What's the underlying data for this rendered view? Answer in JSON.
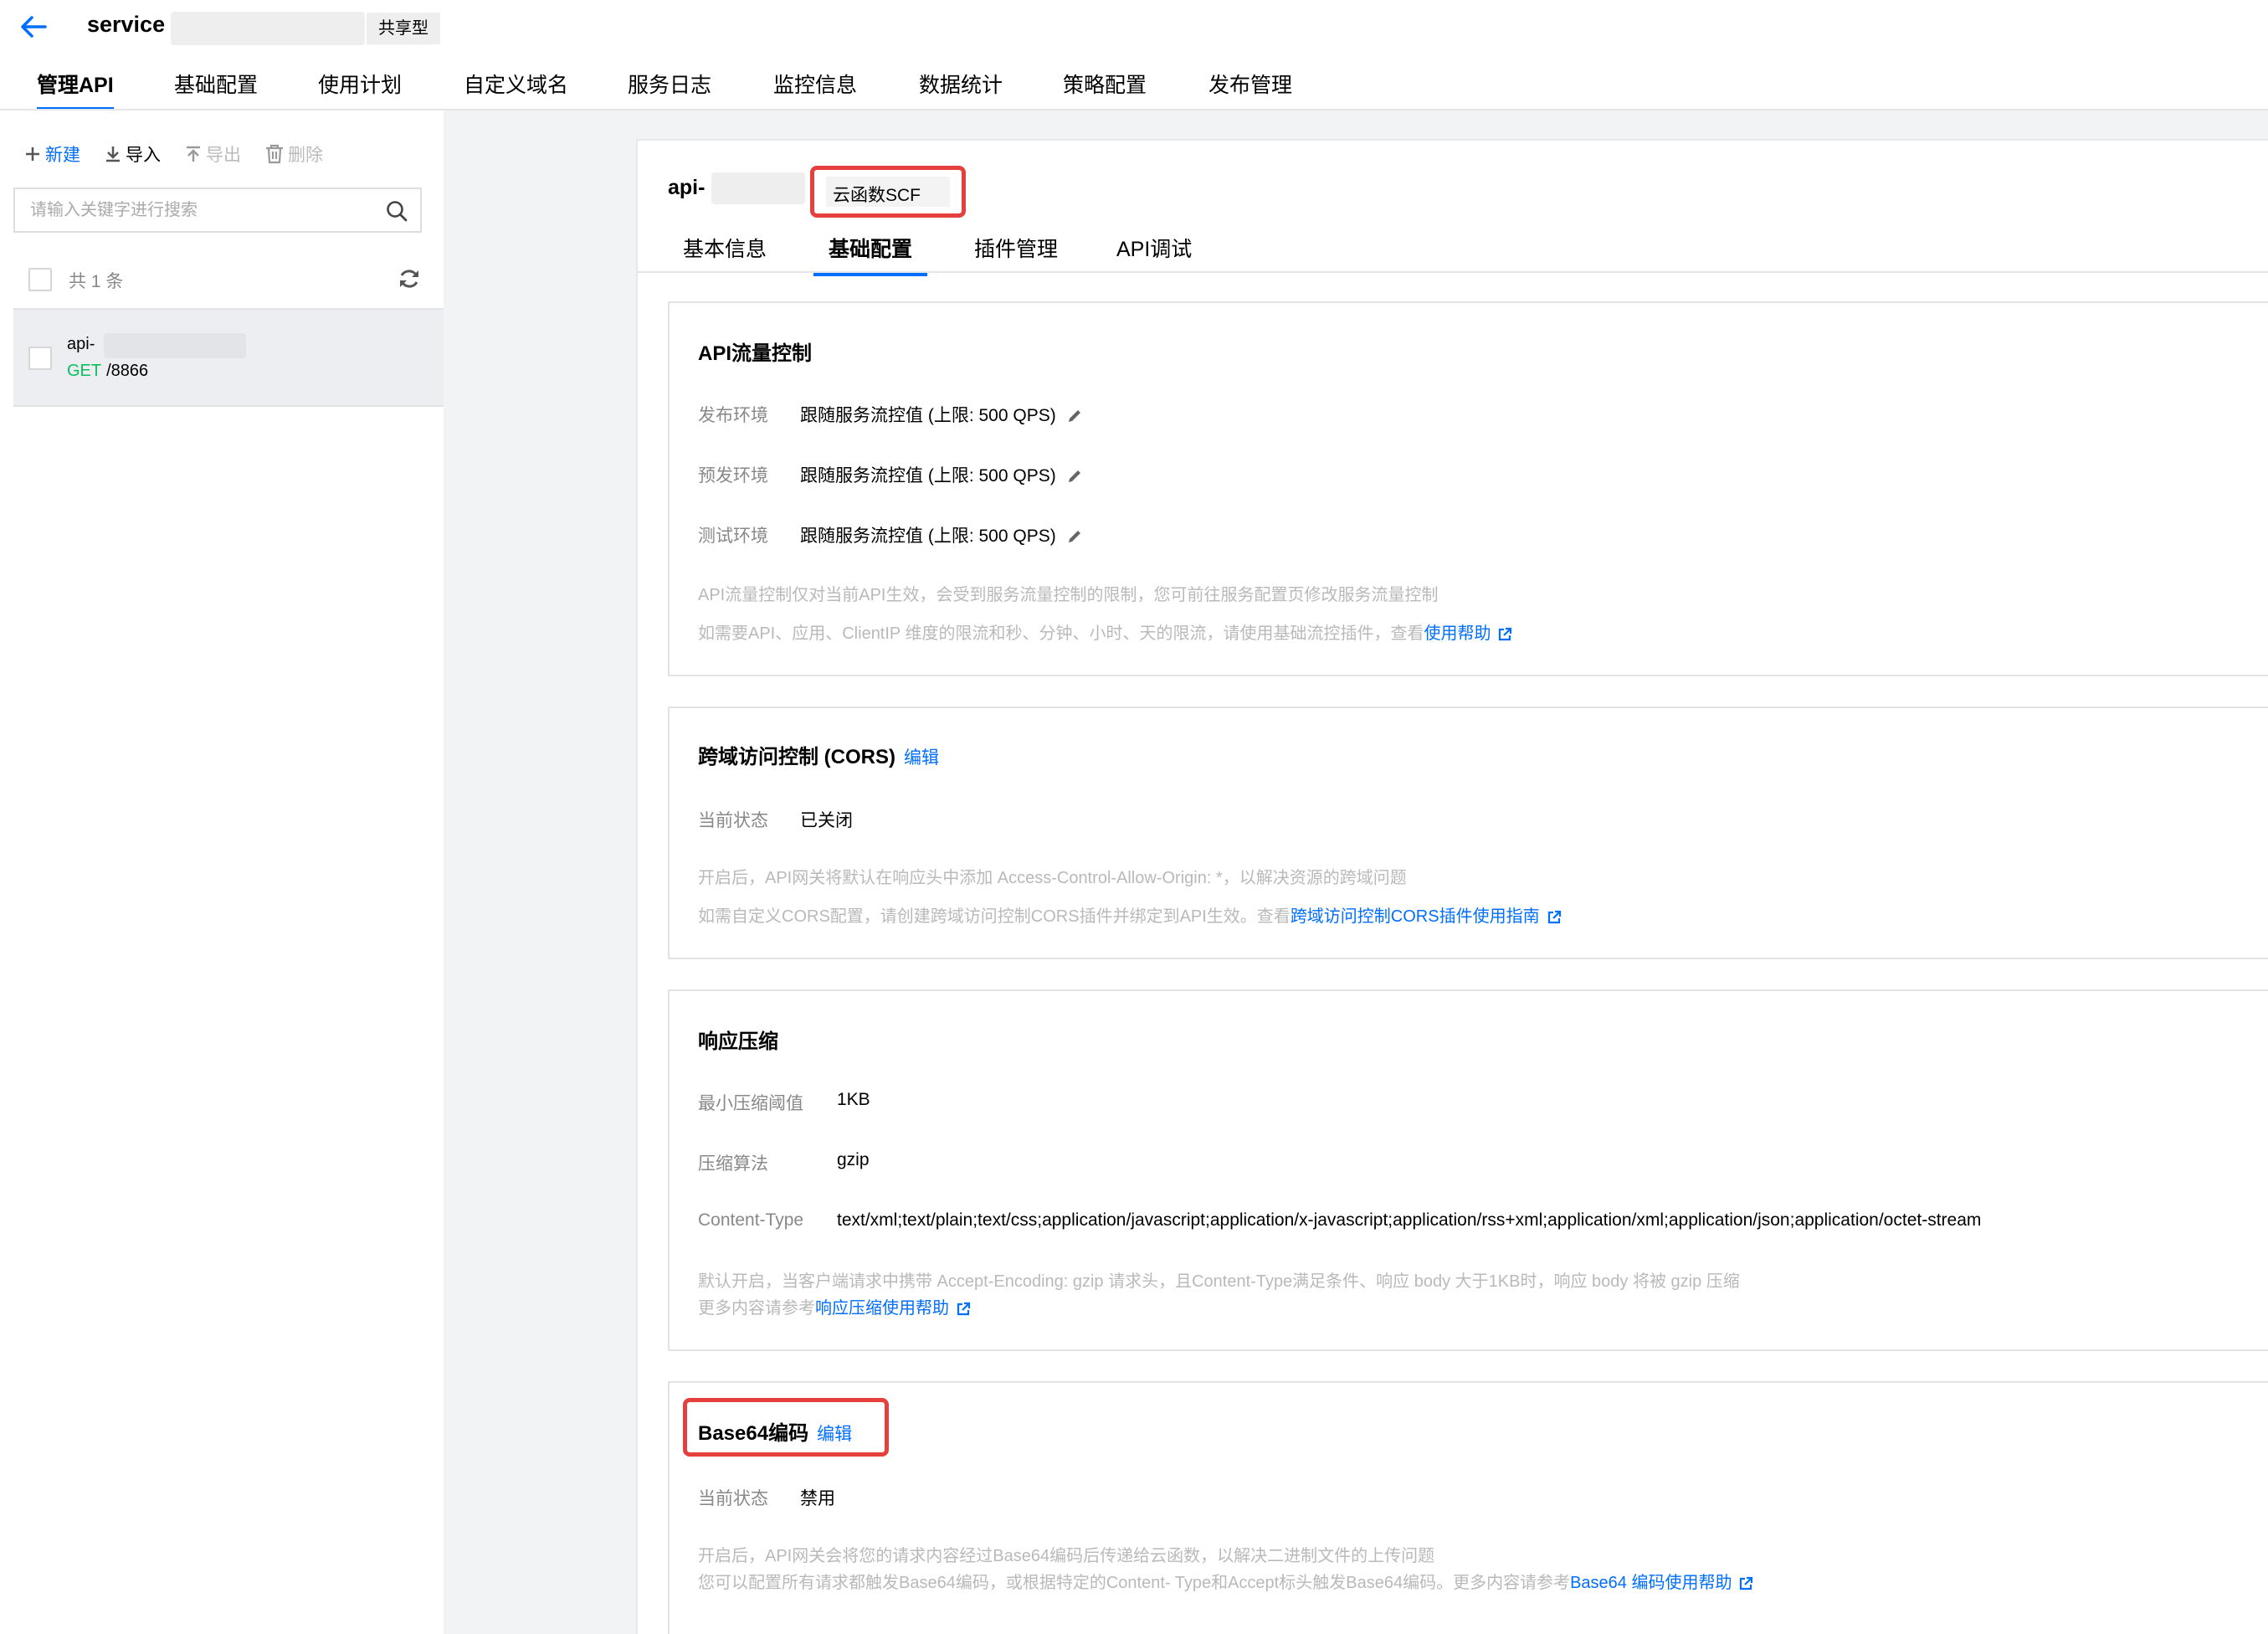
{
  "header": {
    "service_name": "service",
    "service_type": "共享型"
  },
  "main_tabs": [
    {
      "label": "管理API",
      "active": true
    },
    {
      "label": "基础配置"
    },
    {
      "label": "使用计划"
    },
    {
      "label": "自定义域名"
    },
    {
      "label": "服务日志"
    },
    {
      "label": "监控信息"
    },
    {
      "label": "数据统计"
    },
    {
      "label": "策略配置"
    },
    {
      "label": "发布管理"
    }
  ],
  "left_panel": {
    "toolbar": {
      "new": "新建",
      "import": "导入",
      "export": "导出",
      "delete": "删除"
    },
    "search_placeholder": "请输入关键字进行搜索",
    "count_text": "共 1 条",
    "api_item": {
      "name": "api-",
      "method": "GET",
      "path": "/8866"
    }
  },
  "detail": {
    "api_name": "api-",
    "backend_type": "云函数SCF",
    "tabs": [
      {
        "label": "基本信息"
      },
      {
        "label": "基础配置",
        "active": true
      },
      {
        "label": "插件管理"
      },
      {
        "label": "API调试"
      }
    ],
    "rate_limit": {
      "title": "API流量控制",
      "rows": [
        {
          "label": "发布环境",
          "value": "跟随服务流控值 (上限: 500 QPS)"
        },
        {
          "label": "预发环境",
          "value": "跟随服务流控值 (上限: 500 QPS)"
        },
        {
          "label": "测试环境",
          "value": "跟随服务流控值 (上限: 500 QPS)"
        }
      ],
      "note1": "API流量控制仅对当前API生效，会受到服务流量控制的限制，您可前往服务配置页修改服务流量控制",
      "note2": "如需要API、应用、ClientIP 维度的限流和秒、分钟、小时、天的限流，请使用基础流控插件，查看",
      "note2_link": "使用帮助"
    },
    "cors": {
      "title": "跨域访问控制 (CORS)",
      "edit": "编辑",
      "status_label": "当前状态",
      "status_value": "已关闭",
      "note1": "开启后，API网关将默认在响应头中添加 Access-Control-Allow-Origin: *，以解决资源的跨域问题",
      "note2": "如需自定义CORS配置，请创建跨域访问控制CORS插件并绑定到API生效。查看",
      "note2_link": "跨域访问控制CORS插件使用指南"
    },
    "compression": {
      "title": "响应压缩",
      "min_label": "最小压缩阈值",
      "min_value": "1KB",
      "algo_label": "压缩算法",
      "algo_value": "gzip",
      "ct_label": "Content-Type",
      "ct_value": "text/xml;text/plain;text/css;application/javascript;application/x-javascript;application/rss+xml;application/xml;application/json;application/octet-stream",
      "note1": "默认开启，当客户端请求中携带 Accept-Encoding: gzip 请求头，且Content-Type满足条件、响应 body 大于1KB时，响应 body 将被 gzip 压缩",
      "note2": "更多内容请参考",
      "note2_link": "响应压缩使用帮助"
    },
    "base64": {
      "title": "Base64编码",
      "edit": "编辑",
      "status_label": "当前状态",
      "status_value": "禁用",
      "note1": "开启后，API网关会将您的请求内容经过Base64编码后传递给云函数，以解决二进制文件的上传问题",
      "note2": "您可以配置所有请求都触发Base64编码，或根据特定的Content- Type和Accept标头触发Base64编码。更多内容请参考",
      "note2_link": "Base64 编码使用帮助"
    }
  },
  "colors": {
    "accent": "#006eff",
    "highlight": "#e5403e",
    "get_method": "#0abf5b"
  }
}
